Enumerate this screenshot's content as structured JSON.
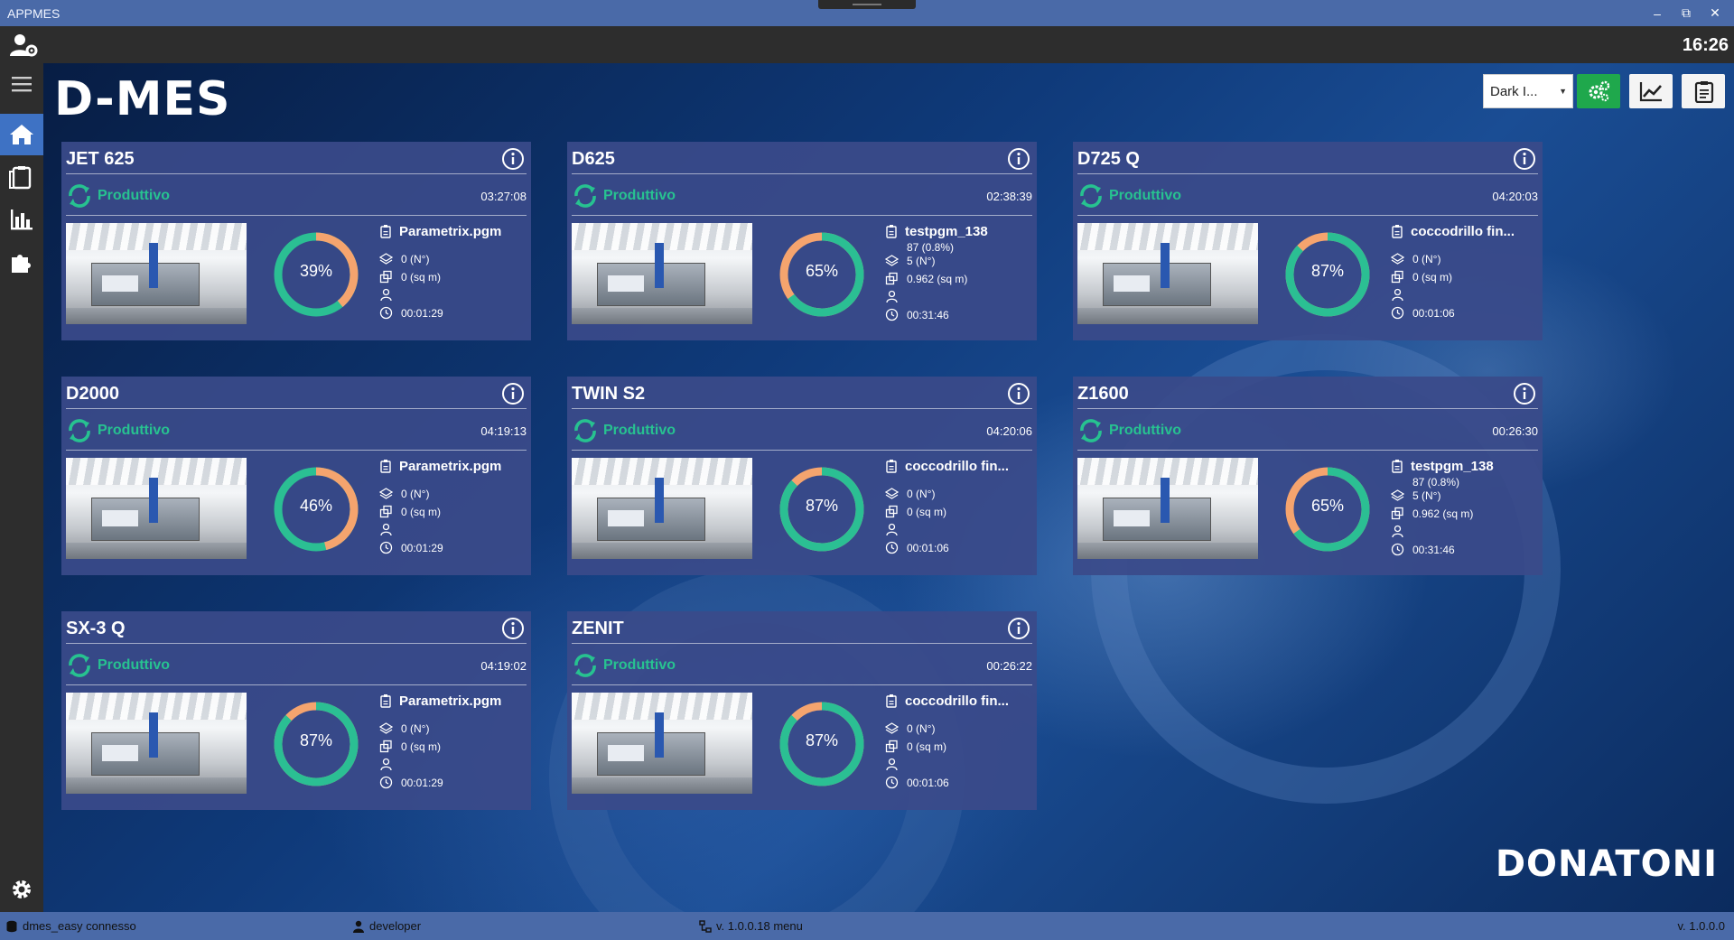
{
  "window": {
    "title": "APPMES"
  },
  "topbar": {
    "clock": "16:26"
  },
  "app": {
    "logo": "D-MES",
    "brand": "DONATONI"
  },
  "toolbar": {
    "theme_selected": "Dark I..."
  },
  "colors": {
    "ring_orange": "#f5a46e",
    "ring_green": "#2bbf93",
    "status_green": "#27c290",
    "card_bg": "#3a4a8a"
  },
  "machines": [
    {
      "name": "JET 625",
      "status": "Produttivo",
      "time": "03:27:08",
      "percent_label": "39%",
      "percent": 39,
      "ring": "orange",
      "program": "Parametrix.pgm",
      "extra1": "",
      "extra2": "",
      "pieces": "0 (N°)",
      "area": "0 (sq m)",
      "duration": "00:01:29"
    },
    {
      "name": "D625",
      "status": "Produttivo",
      "time": "02:38:39",
      "percent_label": "65%",
      "percent": 65,
      "ring": "green",
      "program": "testpgm_138",
      "extra1": "87 (0.8%)",
      "extra2": "",
      "pieces": "5 (N°)",
      "area": "0.962 (sq m)",
      "duration": "00:31:46"
    },
    {
      "name": "D725 Q",
      "status": "Produttivo",
      "time": "04:20:03",
      "percent_label": "87%",
      "percent": 87,
      "ring": "green",
      "program": "coccodrillo fin...",
      "extra1": "",
      "extra2": "",
      "pieces": "0 (N°)",
      "area": "0 (sq m)",
      "duration": "00:01:06"
    },
    {
      "name": "D2000",
      "status": "Produttivo",
      "time": "04:19:13",
      "percent_label": "46%",
      "percent": 46,
      "ring": "orange",
      "program": "Parametrix.pgm",
      "extra1": "",
      "extra2": "",
      "pieces": "0 (N°)",
      "area": "0 (sq m)",
      "duration": "00:01:29"
    },
    {
      "name": "TWIN S2",
      "status": "Produttivo",
      "time": "04:20:06",
      "percent_label": "87%",
      "percent": 87,
      "ring": "green",
      "program": "coccodrillo fin...",
      "extra1": "",
      "extra2": "",
      "pieces": "0 (N°)",
      "area": "0 (sq m)",
      "duration": "00:01:06"
    },
    {
      "name": "Z1600",
      "status": "Produttivo",
      "time": "00:26:30",
      "percent_label": "65%",
      "percent": 65,
      "ring": "green",
      "program": "testpgm_138",
      "extra1": "87 (0.8%)",
      "extra2": "",
      "pieces": "5 (N°)",
      "area": "0.962 (sq m)",
      "duration": "00:31:46"
    },
    {
      "name": "SX-3 Q",
      "status": "Produttivo",
      "time": "04:19:02",
      "percent_label": "87%",
      "percent": 87,
      "ring": "green",
      "program": "Parametrix.pgm",
      "extra1": "",
      "extra2": "",
      "pieces": "0 (N°)",
      "area": "0 (sq m)",
      "duration": "00:01:29"
    },
    {
      "name": "ZENIT",
      "status": "Produttivo",
      "time": "00:26:22",
      "percent_label": "87%",
      "percent": 87,
      "ring": "green",
      "program": "coccodrillo fin...",
      "extra1": "",
      "extra2": "",
      "pieces": "0 (N°)",
      "area": "0 (sq m)",
      "duration": "00:01:06"
    }
  ],
  "statusbar": {
    "db": "dmes_easy connesso",
    "user": "developer",
    "menu": "v. 1.0.0.18 menu",
    "version": "v. 1.0.0.0"
  }
}
